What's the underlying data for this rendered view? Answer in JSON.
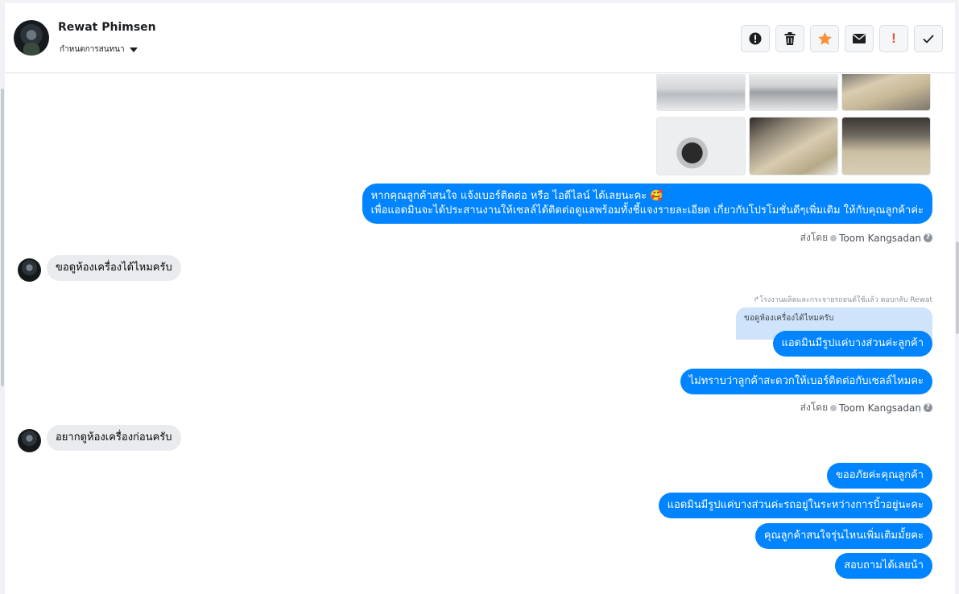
{
  "header": {
    "name": "Rewat Phimsen",
    "subtitle": "กำหนดการสนทนา"
  },
  "actions": [
    {
      "icon": "alert-circle-icon",
      "color": "#1c1e21"
    },
    {
      "icon": "trash-icon",
      "color": "#1c1e21"
    },
    {
      "icon": "star-icon",
      "color": "#f7923b"
    },
    {
      "icon": "mail-icon",
      "color": "#1c1e21"
    },
    {
      "icon": "exclamation-icon",
      "color": "#e4512f"
    },
    {
      "icon": "checkmark-icon",
      "color": "#1c1e21"
    }
  ],
  "messages": {
    "out1_line1": "หากคุณลูกค้าสนใจ แจ้งเบอร์ติดต่อ หรือ ไอดีไลน์ ได้เลยนะคะ 🥰",
    "out1_line2": "เพื่อแอดมินจะได้ประสานงานให้เซลล์ได้ติดต่อดูแลพร้อมทั้งชี้แจงรายละเอียด เกี่ยวกับโปรโมชั่นดีๆเพิ่มเติม ให้กับคุณลูกค้าค่ะ",
    "sent_by_1_prefix": "ส่งโดย",
    "sent_by_1_agent": "Toom Kangsadan",
    "in1": "ขอดูห้องเครื่องได้ไหมครับ",
    "reply_note": "โรงงานผลิตและกระจายรถยนต์ใช้แล้ว ตอบกลับ Rewat",
    "quote": "ขอดูห้องเครื่องได้ไหมครับ",
    "out2": "แอดมินมีรูปแค่บางส่วนค่ะลูกค้า",
    "out3": "ไม่ทราบว่าลูกค้าสะดวกให้เบอร์ติดต่อกับเซลล์ไหมคะ",
    "sent_by_2_prefix": "ส่งโดย",
    "sent_by_2_agent": "Toom Kangsadan",
    "in2": "อยากดูห้องเครื่องก่อนครับ",
    "out4": "ขออภัยค่ะคุณลูกค้า",
    "out5": "แอดมินมีรูปแค่บางส่วนค่ะรถอยู่ในระหว่างการบิ้วอยู่นะคะ",
    "out6": "คุณลูกค้าสนใจรุ่นไหนเพิ่มเติมมั้ยคะ",
    "out7": "สอบถามได้เลยน้า"
  },
  "colors": {
    "outgoing_bubble": "#0084ff",
    "incoming_bubble": "#e9ebee",
    "quote_bubble": "#cfe4fb"
  }
}
